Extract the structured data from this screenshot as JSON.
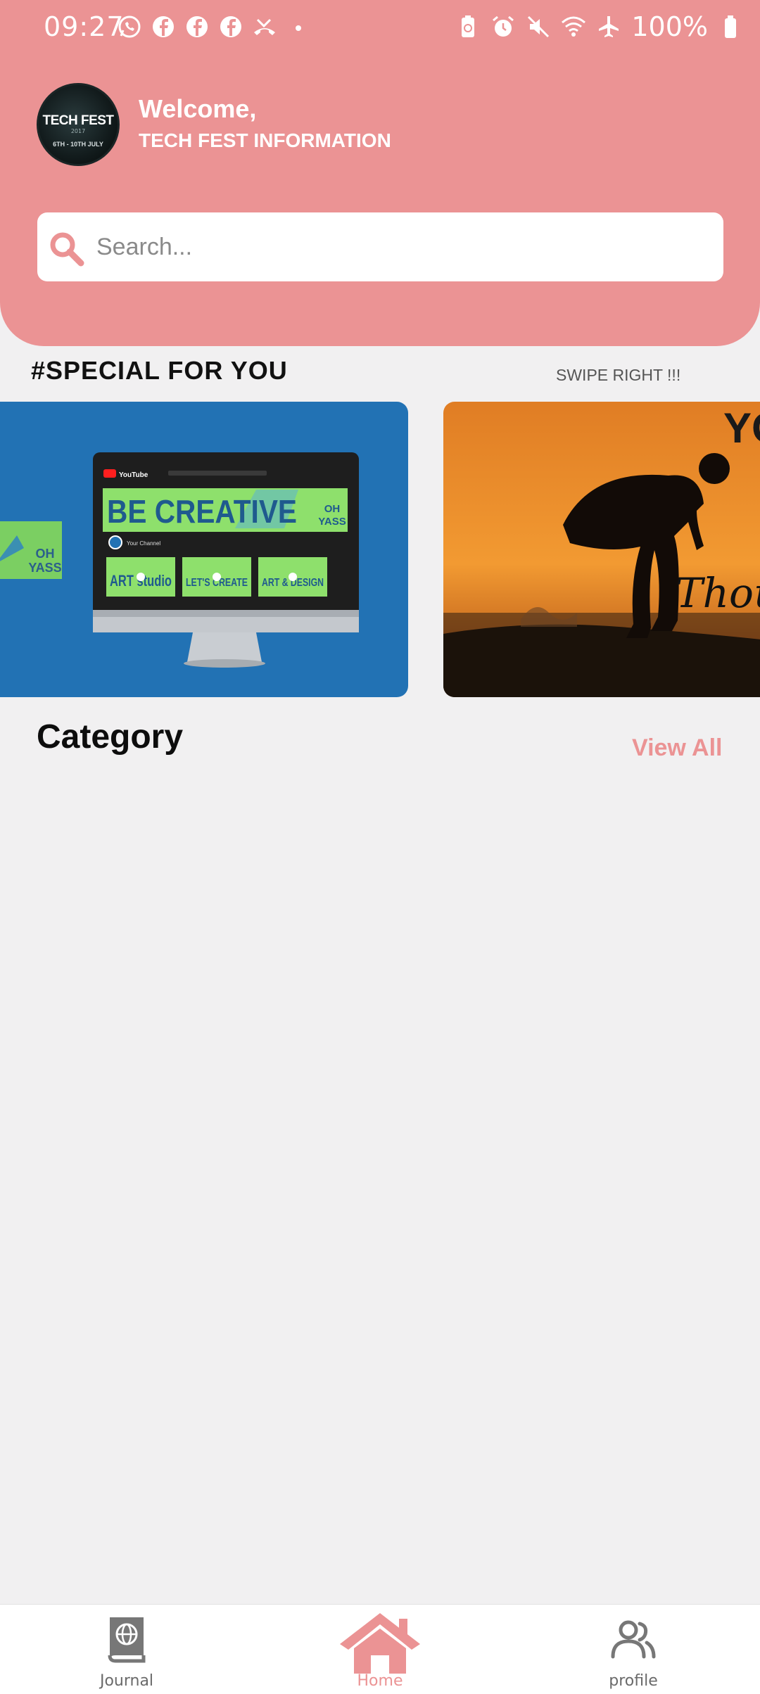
{
  "status_bar": {
    "time": "09:27",
    "battery_text": "100%",
    "left_icons": [
      "whatsapp-icon",
      "facebook-icon",
      "facebook-icon",
      "facebook-icon",
      "missed-call-icon",
      "dot-icon"
    ],
    "right_icons": [
      "battery-saver-icon",
      "alarm-icon",
      "mute-icon",
      "wifi-icon",
      "airplane-icon",
      "battery-icon"
    ]
  },
  "header": {
    "logo": {
      "title": "TECH FEST",
      "year": "2017",
      "date": "6TH - 10TH JULY"
    },
    "welcome": "Welcome,",
    "subtitle": "TECH FEST INFORMATION"
  },
  "search": {
    "placeholder": "Search...",
    "value": ""
  },
  "special": {
    "title": "#SPECIAL FOR YOU",
    "hint": "SWIPE RIGHT !!!",
    "cards": [
      {
        "name": "be-creative-card",
        "side_badge": "OH\nYASS",
        "banner_text": "BE CREATIVE",
        "banner_badge": "OH\nYASS",
        "thumbs": [
          "ART studio",
          "LET'S CREATE",
          "ART & DESIGN"
        ],
        "channel": "Your Channel",
        "app": "YouTube"
      },
      {
        "name": "thoughts-card",
        "top_text": "YO",
        "script_text": "Though"
      }
    ]
  },
  "category": {
    "title": "Category",
    "view_all": "View All"
  },
  "nav": {
    "items": [
      {
        "label": "Journal",
        "icon": "journal-globe-icon",
        "active": false
      },
      {
        "label": "Home",
        "icon": "home-icon",
        "active": true
      },
      {
        "label": "profile",
        "icon": "profile-users-icon",
        "active": false
      }
    ]
  },
  "colors": {
    "accent": "#eb9394",
    "background": "#f1f0f1",
    "card_blue": "#2272b4",
    "card_orange": "#f29a32",
    "nav_inactive": "#6a6a6a"
  }
}
